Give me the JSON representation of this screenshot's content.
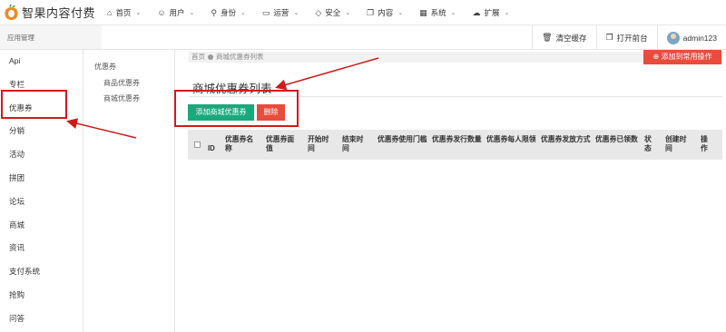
{
  "app": {
    "title": "智果内容付费"
  },
  "topnav": [
    {
      "icon": "home-icon",
      "glyph": "⌂",
      "label": "首页"
    },
    {
      "icon": "user-icon",
      "glyph": "☺",
      "label": "用户"
    },
    {
      "icon": "identity-icon",
      "glyph": "⚲",
      "label": "身份"
    },
    {
      "icon": "monitor-icon",
      "glyph": "▭",
      "label": "运营"
    },
    {
      "icon": "shield-icon",
      "glyph": "◇",
      "label": "安全"
    },
    {
      "icon": "copy-icon",
      "glyph": "❐",
      "label": "内容"
    },
    {
      "icon": "grid-icon",
      "glyph": "▦",
      "label": "系统"
    },
    {
      "icon": "cloud-icon",
      "glyph": "☁",
      "label": "扩展"
    }
  ],
  "subbar": {
    "label": "应用管理"
  },
  "tools": {
    "clear_cache": "清空缓存",
    "open_front": "打开前台",
    "user": "admin123"
  },
  "sidebar": {
    "items": [
      {
        "label": "Api"
      },
      {
        "label": "专栏"
      },
      {
        "label": "优惠券"
      },
      {
        "label": "分销"
      },
      {
        "label": "活动"
      },
      {
        "label": "拼团"
      },
      {
        "label": "论坛"
      },
      {
        "label": "商城"
      },
      {
        "label": "资讯"
      },
      {
        "label": "支付系统"
      },
      {
        "label": "抢购"
      },
      {
        "label": "问答"
      }
    ]
  },
  "submenu": {
    "group": "优惠券",
    "items": [
      {
        "label": "商品优惠券"
      },
      {
        "label": "商城优惠券"
      }
    ]
  },
  "breadcrumb": {
    "home": "首页",
    "current": "商城优惠券列表"
  },
  "quick_add": "添加到常用操作",
  "page_title": "商城优惠券列表",
  "buttons": {
    "add": "添加商城优惠券",
    "delete": "删除"
  },
  "table": {
    "columns": [
      "ID",
      "优惠券名称",
      "优惠券面值",
      "开始时间",
      "结束时间",
      "优惠券使用门槛",
      "优惠券发行数量",
      "优惠券每人限领",
      "优惠券发放方式",
      "优惠券已领数",
      "状态",
      "创建时间",
      "操作"
    ]
  },
  "colors": {
    "accent_green": "#1aa97b",
    "accent_red": "#e74c3c",
    "annotation_red": "#d01a1a"
  }
}
